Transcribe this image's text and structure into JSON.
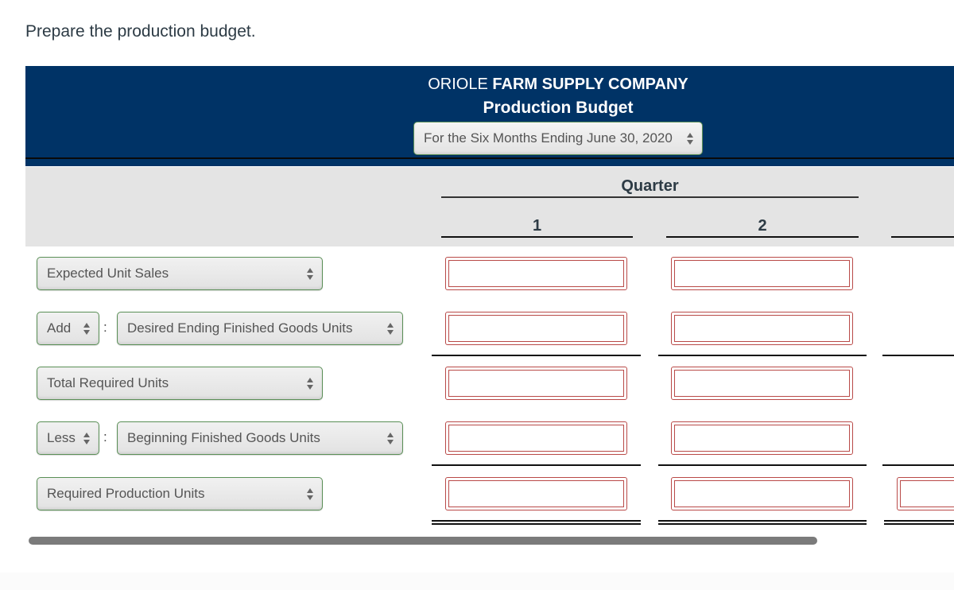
{
  "instruction": "Prepare the production budget.",
  "header": {
    "company_prefix": "ORIOLE",
    "company_name": "FARM SUPPLY COMPANY",
    "report_title": "Production Budget",
    "period_select": {
      "selected": "For the Six Months Ending June 30, 2020"
    }
  },
  "columns": {
    "group_label": "Quarter",
    "quarters": [
      "1",
      "2"
    ]
  },
  "rows": [
    {
      "label_select": "Expected Unit Sales",
      "operator": null,
      "values": [
        "",
        ""
      ]
    },
    {
      "label_select": "Desired Ending Finished Goods Units",
      "operator": "Add",
      "values": [
        "",
        ""
      ]
    },
    {
      "label_select": "Total Required Units",
      "operator": null,
      "values": [
        "",
        ""
      ]
    },
    {
      "label_select": "Beginning Finished Goods Units",
      "operator": "Less",
      "values": [
        "",
        ""
      ]
    },
    {
      "label_select": "Required Production Units",
      "operator": null,
      "values": [
        "",
        "",
        ""
      ]
    }
  ],
  "separator": ":",
  "colors": {
    "header_bg": "#003366",
    "column_band_bg": "#e4e4e4",
    "select_border": "#5a8f56",
    "input_border": "#b94a48",
    "scrollbar_thumb": "#7b7b7b"
  }
}
